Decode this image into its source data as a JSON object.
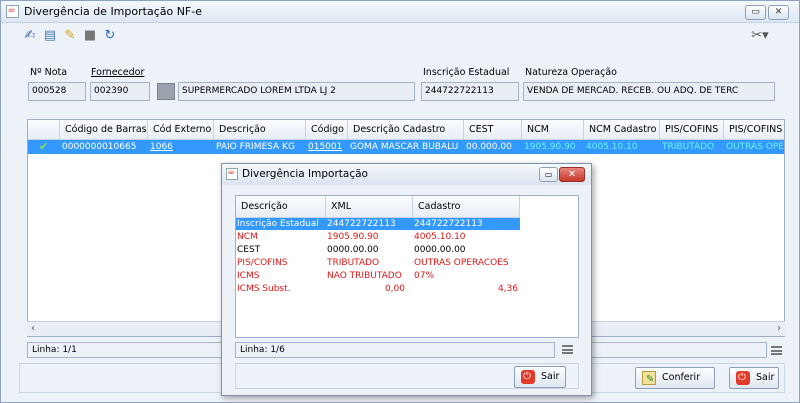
{
  "window": {
    "title": "Divergência de Importação NF-e"
  },
  "toolbar": {
    "icons": [
      "user-edit-icon",
      "window-icon",
      "edit-note-icon",
      "print-icon",
      "refresh-icon",
      "tools-icon"
    ]
  },
  "header": {
    "nota_label": "Nº Nota",
    "nota_value": "000528",
    "fornecedor_label": "Fornecedor",
    "fornecedor_code": "002390",
    "fornecedor_name": "SUPERMERCADO LOREM LTDA LJ 2",
    "ie_label": "Inscrição Estadual",
    "ie_value": "244722722113",
    "natureza_label": "Natureza Operação",
    "natureza_value": "VENDA DE MERCAD. RECEB. OU ADQ. DE TERC"
  },
  "grid": {
    "columns": [
      "Código de Barras",
      "Cód Externo",
      "Descrição",
      "Código",
      "Descrição Cadastro",
      "CEST",
      "NCM",
      "NCM Cadastro",
      "PIS/COFINS",
      "PIS/COFINS"
    ],
    "row": {
      "codigo_barras": "0000000010665",
      "cod_externo": "1066",
      "descricao": "PAIO FRIMESA KG",
      "codigo": "015001",
      "descricao_cadastro": "GOMA MASCAR BUBALU",
      "cest": "00.000.00",
      "ncm": "1905.90.90",
      "ncm_cadastro": "4005.10.10",
      "pis_cofins": "TRIBUTADO",
      "pis_cofins_cad": "OUTRAS OPE"
    }
  },
  "status": {
    "linha": "Linha: 1/1"
  },
  "buttons": {
    "conferir": "Conferir",
    "sair": "Sair"
  },
  "dialog": {
    "title": "Divergência Importação",
    "columns": [
      "Descrição",
      "XML",
      "Cadastro"
    ],
    "rows": [
      {
        "descricao": "Inscrição Estadual",
        "xml": "244722722113",
        "cadastro": "244722722113"
      },
      {
        "descricao": "NCM",
        "xml": "1905.90.90",
        "cadastro": "4005.10.10"
      },
      {
        "descricao": "CEST",
        "xml": "0000.00.00",
        "cadastro": "0000.00.00"
      },
      {
        "descricao": "PIS/COFINS",
        "xml": "TRIBUTADO",
        "cadastro": "OUTRAS OPERACOES"
      },
      {
        "descricao": "ICMS",
        "xml": "NAO TRIBUTADO",
        "cadastro": "07%"
      },
      {
        "descricao": "ICMS Subst.",
        "xml": "0,00",
        "cadastro": "4,36"
      }
    ],
    "linha": "Linha: 1/6",
    "sair": "Sair"
  }
}
